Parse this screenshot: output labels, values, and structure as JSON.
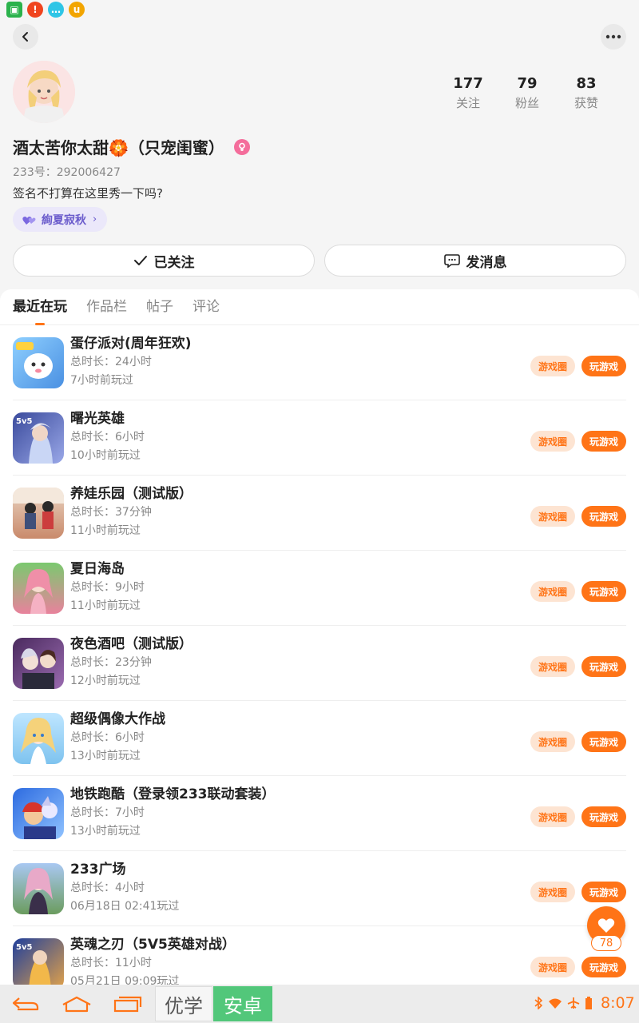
{
  "status_icons": [
    {
      "icon": "image-icon",
      "color": "#2bb24c",
      "glyph": "▣"
    },
    {
      "icon": "alert-icon",
      "color": "#f0441e",
      "glyph": "!"
    },
    {
      "icon": "chat-icon",
      "color": "#2ec5e6",
      "glyph": "…"
    },
    {
      "icon": "uc-icon",
      "color": "#f2a500",
      "glyph": "u"
    }
  ],
  "profile": {
    "nickname": "酒太苦你太甜🏵️（只宠闺蜜）",
    "id_line": "233号：292006427",
    "signature": "签名不打算在这里秀一下吗?",
    "tag": "絢夏寂秋",
    "stats": [
      {
        "num": "177",
        "label": "关注"
      },
      {
        "num": "79",
        "label": "粉丝"
      },
      {
        "num": "83",
        "label": "获赞"
      }
    ]
  },
  "actions": {
    "follow_label": "已关注",
    "message_label": "发消息"
  },
  "tabs": [
    "最近在玩",
    "作品栏",
    "帖子",
    "评论"
  ],
  "buttons": {
    "circle": "游戏圈",
    "play": "玩游戏"
  },
  "games": [
    {
      "name": "蛋仔派对(周年狂欢)",
      "duration": "总时长：24小时",
      "last": "7小时前玩过",
      "color": "#6fb6f2"
    },
    {
      "name": "曙光英雄",
      "duration": "总时长：6小时",
      "last": "10小时前玩过",
      "color": "#5a64b8"
    },
    {
      "name": "养娃乐园（测试版）",
      "duration": "总时长：37分钟",
      "last": "11小时前玩过",
      "color": "#c98a6b"
    },
    {
      "name": "夏日海岛",
      "duration": "总时长：9小时",
      "last": "11小时前玩过",
      "color": "#e8829c"
    },
    {
      "name": "夜色酒吧（测试版）",
      "duration": "总时长：23分钟",
      "last": "12小时前玩过",
      "color": "#7a4b8f"
    },
    {
      "name": "超级偶像大作战",
      "duration": "总时长：6小时",
      "last": "13小时前玩过",
      "color": "#7ec3ef"
    },
    {
      "name": "地铁跑酷（登录领233联动套装）",
      "duration": "总时长：7小时",
      "last": "13小时前玩过",
      "color": "#3f7fe0"
    },
    {
      "name": "233广场",
      "duration": "总时长：4小时",
      "last": "06月18日 02:41玩过",
      "color": "#8fb0e8"
    },
    {
      "name": "英魂之刃（5V5英雄对战）",
      "duration": "总时长：11小时",
      "last": "05月21日 09:09玩过",
      "color": "#2f5fc4"
    }
  ],
  "fab": {
    "count": "78"
  },
  "navbar": {
    "ime_left": "优学",
    "ime_right": "安卓",
    "clock": "8:07"
  },
  "colors": {
    "accent": "#ff7417",
    "tag": "#6b5ccc",
    "ime_green": "#52c77a"
  }
}
